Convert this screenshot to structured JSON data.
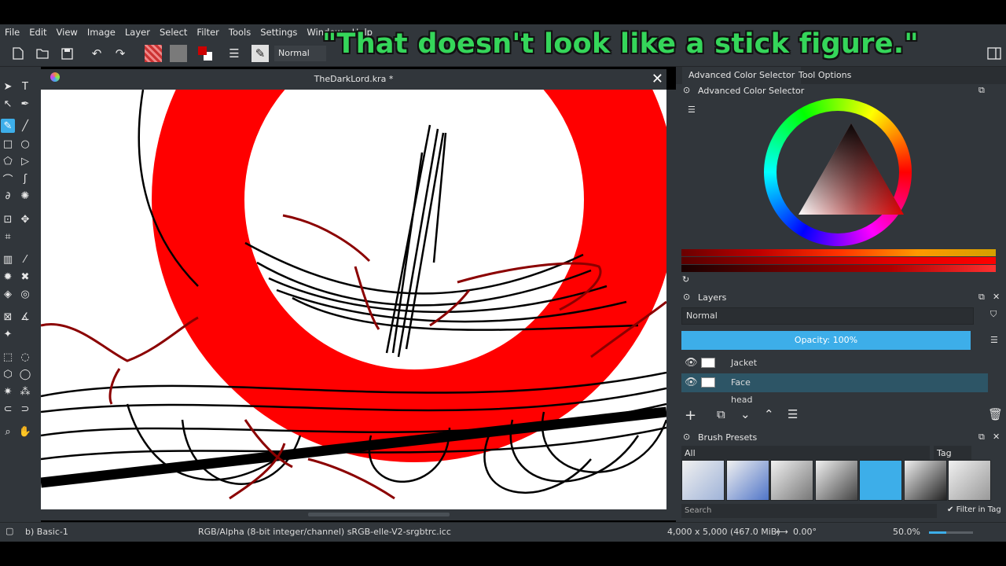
{
  "menu": [
    "File",
    "Edit",
    "View",
    "Image",
    "Layer",
    "Select",
    "Filter",
    "Tools",
    "Settings",
    "Window",
    "Help"
  ],
  "toolbar": {
    "blend_mode": "Normal"
  },
  "caption": "\"That doesn't look like a stick figure.\"",
  "document": {
    "title": "TheDarkLord.kra *",
    "close_glyph": "✕"
  },
  "dock": {
    "tabs": [
      "Advanced Color Selector",
      "Tool Options"
    ],
    "color_selector_title": "Advanced Color Selector",
    "layers": {
      "title": "Layers",
      "blend_mode": "Normal",
      "opacity_label": "Opacity:  100%",
      "items": [
        {
          "name": "Jacket"
        },
        {
          "name": "Face"
        },
        {
          "name": "head"
        }
      ]
    },
    "brush_presets": {
      "title": "Brush Presets",
      "filter": "All",
      "tag_label": "Tag",
      "search_placeholder": "Search",
      "filter_in_tag": "Filter in Tag",
      "colors": [
        "#e8e8e8",
        "#dde4f0",
        "#d4d4d4",
        "#e0e0e0",
        "#3daee9",
        "#cfcfcf",
        "#e6e6e6"
      ]
    }
  },
  "statusbar": {
    "brush": "b) Basic-1",
    "color_info": "RGB/Alpha (8-bit integer/channel)  sRGB-elle-V2-srgbtrc.icc",
    "dimensions": "4,000 x 5,000 (467.0 MiB)",
    "rotation": "0.00°",
    "zoom": "50.0%"
  }
}
